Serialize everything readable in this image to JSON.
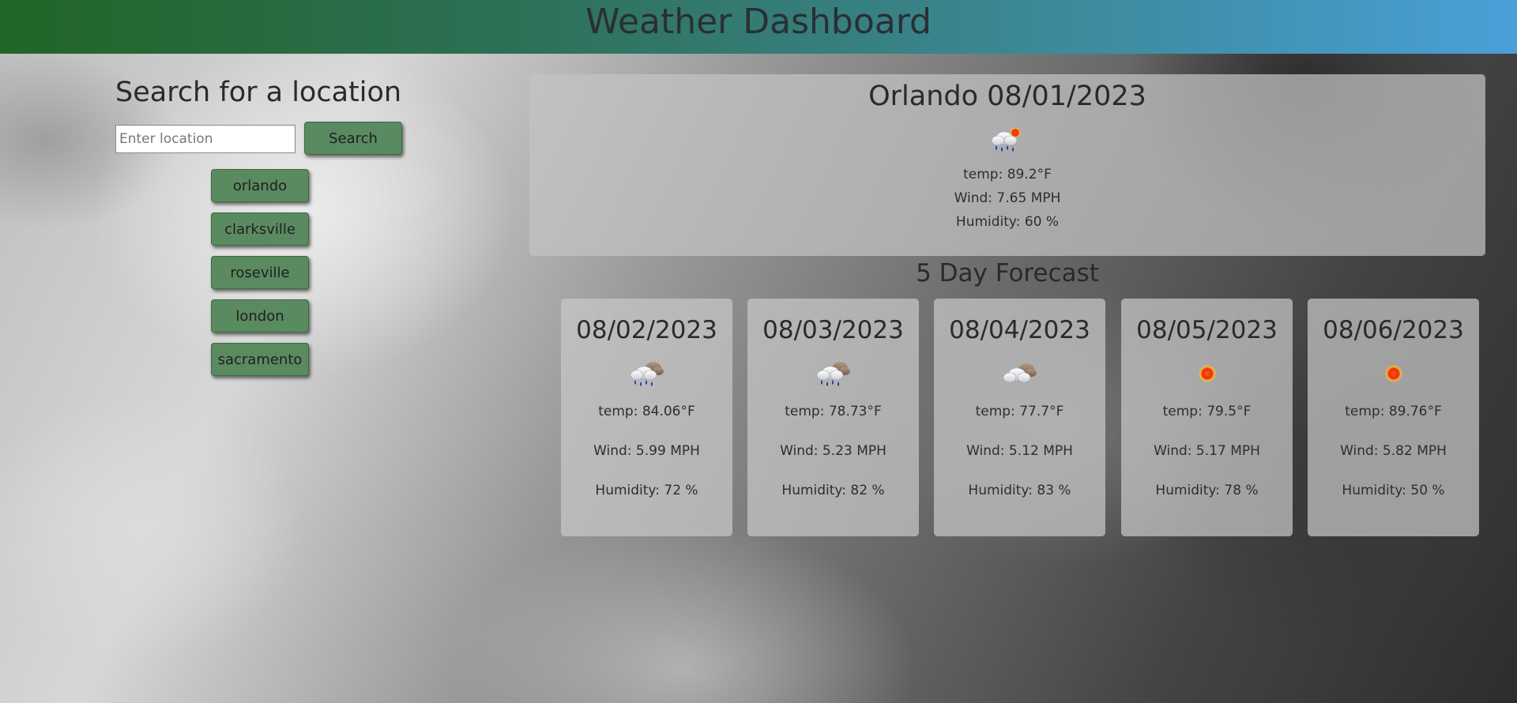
{
  "header": {
    "title": "Weather Dashboard"
  },
  "search": {
    "title": "Search for a location",
    "placeholder": "Enter location",
    "value": "",
    "button_label": "Search"
  },
  "history": [
    {
      "label": "orlando"
    },
    {
      "label": "clarksville"
    },
    {
      "label": "roseville"
    },
    {
      "label": "london"
    },
    {
      "label": "sacramento"
    }
  ],
  "current": {
    "title": "Orlando 08/01/2023",
    "icon": "rain-sun-icon",
    "temp": "temp: 89.2°F",
    "wind": "Wind: 7.65 MPH",
    "humidity": "Humidity: 60 %"
  },
  "forecast": {
    "title": "5 Day Forecast",
    "days": [
      {
        "date": "08/02/2023",
        "icon": "rain-cloud-icon",
        "temp": "temp: 84.06°F",
        "wind": "Wind: 5.99 MPH",
        "humidity": "Humidity: 72 %"
      },
      {
        "date": "08/03/2023",
        "icon": "rain-cloud-icon",
        "temp": "temp: 78.73°F",
        "wind": "Wind: 5.23 MPH",
        "humidity": "Humidity: 82 %"
      },
      {
        "date": "08/04/2023",
        "icon": "cloudy-icon",
        "temp": "temp: 77.7°F",
        "wind": "Wind: 5.12 MPH",
        "humidity": "Humidity: 83 %"
      },
      {
        "date": "08/05/2023",
        "icon": "sun-icon",
        "temp": "temp: 79.5°F",
        "wind": "Wind: 5.17 MPH",
        "humidity": "Humidity: 78 %"
      },
      {
        "date": "08/06/2023",
        "icon": "sun-icon",
        "temp": "temp: 89.76°F",
        "wind": "Wind: 5.82 MPH",
        "humidity": "Humidity: 50 %"
      }
    ]
  },
  "colors": {
    "button": "#5a8a60",
    "header_start": "#226527",
    "header_end": "#4a9fd8"
  }
}
